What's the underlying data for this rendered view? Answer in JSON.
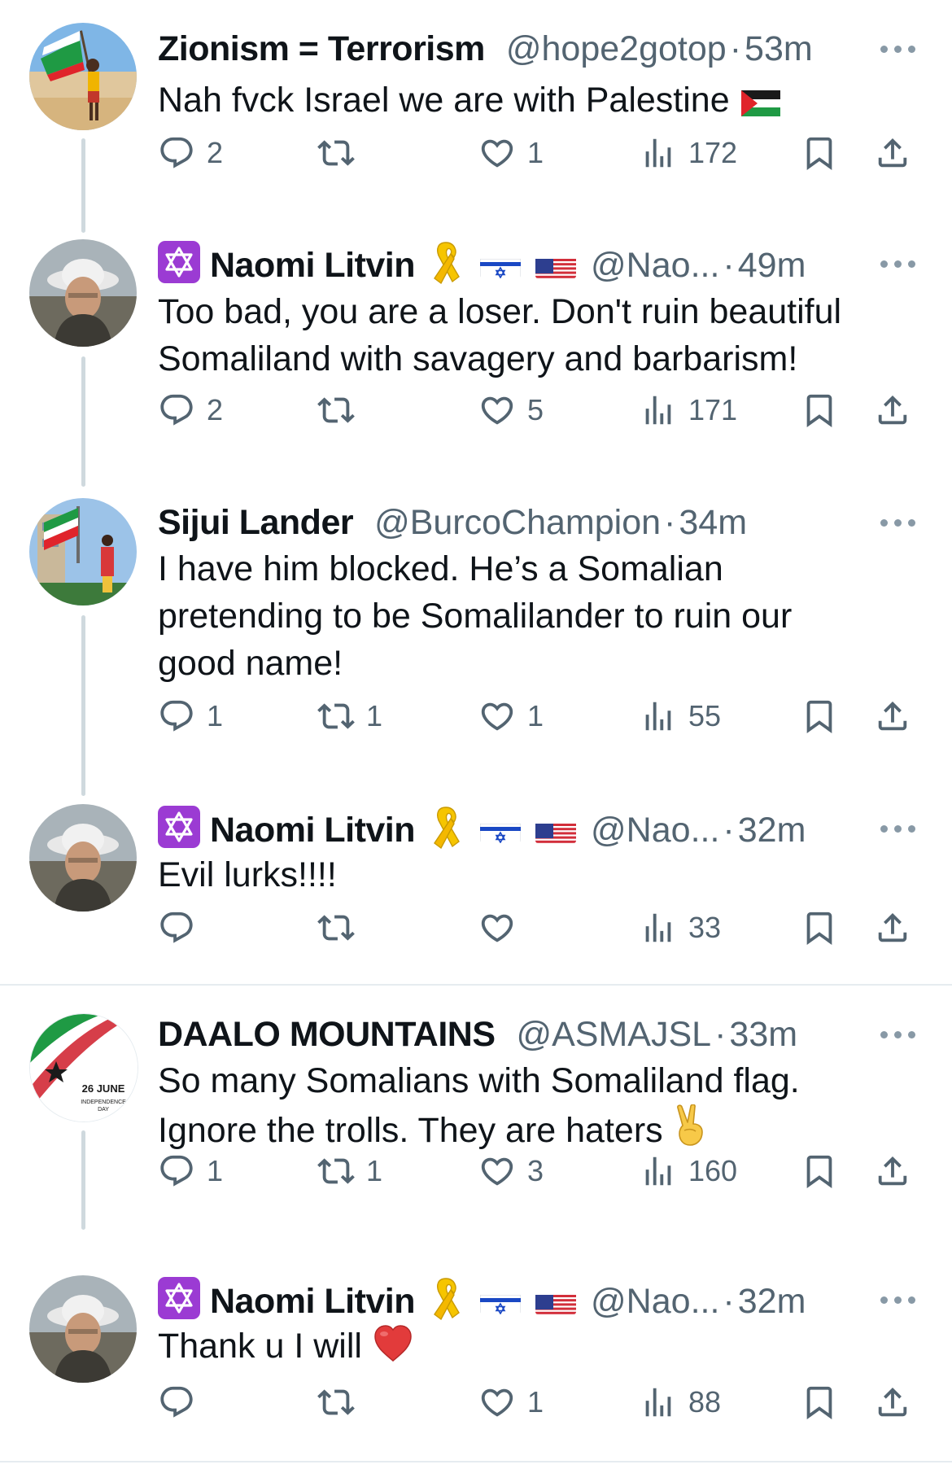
{
  "colors": {
    "text_primary": "#0f1419",
    "text_secondary": "#536471",
    "icon": "#536471",
    "thread_line": "#cfd9de",
    "badge_purple": "#9b3bd3"
  },
  "actions_icons": [
    "reply-icon",
    "retweet-icon",
    "like-icon",
    "views-icon",
    "bookmark-icon",
    "share-icon"
  ],
  "tweets": [
    {
      "name": "Zionism = Terrorism",
      "handle": "@hope2gotop",
      "sep": "·",
      "time": "53m",
      "text": "Nah fvck Israel we are with Palestine",
      "emoji": "palestine-flag",
      "replies": "2",
      "retweets": "",
      "likes": "1",
      "views": "172"
    },
    {
      "name": "Naomi Litvin",
      "handle": "@Nao...",
      "sep": "·",
      "time": "49m",
      "text": "Too bad, you are a loser. Don't ruin beautiful Somaliland with savagery and barbarism!",
      "replies": "2",
      "retweets": "",
      "likes": "5",
      "views": "171"
    },
    {
      "name": "Sijui Lander",
      "handle": "@BurcoChampion",
      "sep": "·",
      "time": "34m",
      "text": "I have him blocked. He’s a Somalian pretending to be Somalilander to ruin our good name!",
      "replies": "1",
      "retweets": "1",
      "likes": "1",
      "views": "55"
    },
    {
      "name": "Naomi Litvin",
      "handle": "@Nao...",
      "sep": "·",
      "time": "32m",
      "text": "Evil lurks!!!!",
      "replies": "",
      "retweets": "",
      "likes": "",
      "views": "33"
    },
    {
      "name": "DAALO MOUNTAINS",
      "handle": "@ASMAJSL",
      "sep": "·",
      "time": "33m",
      "text": "So many Somalians with Somaliland flag. Ignore the trolls. They are haters",
      "emoji": "victory-hand",
      "avatar_caption_1": "26",
      "avatar_caption_2": "JUNE",
      "avatar_caption_3": "INDEPENDENCE",
      "avatar_caption_4": "DAY",
      "replies": "1",
      "retweets": "1",
      "likes": "3",
      "views": "160"
    },
    {
      "name": "Naomi Litvin",
      "handle": "@Nao...",
      "sep": "·",
      "time": "32m",
      "text": "Thank u I will",
      "emoji": "red-heart",
      "replies": "",
      "retweets": "",
      "likes": "1",
      "views": "88"
    }
  ]
}
